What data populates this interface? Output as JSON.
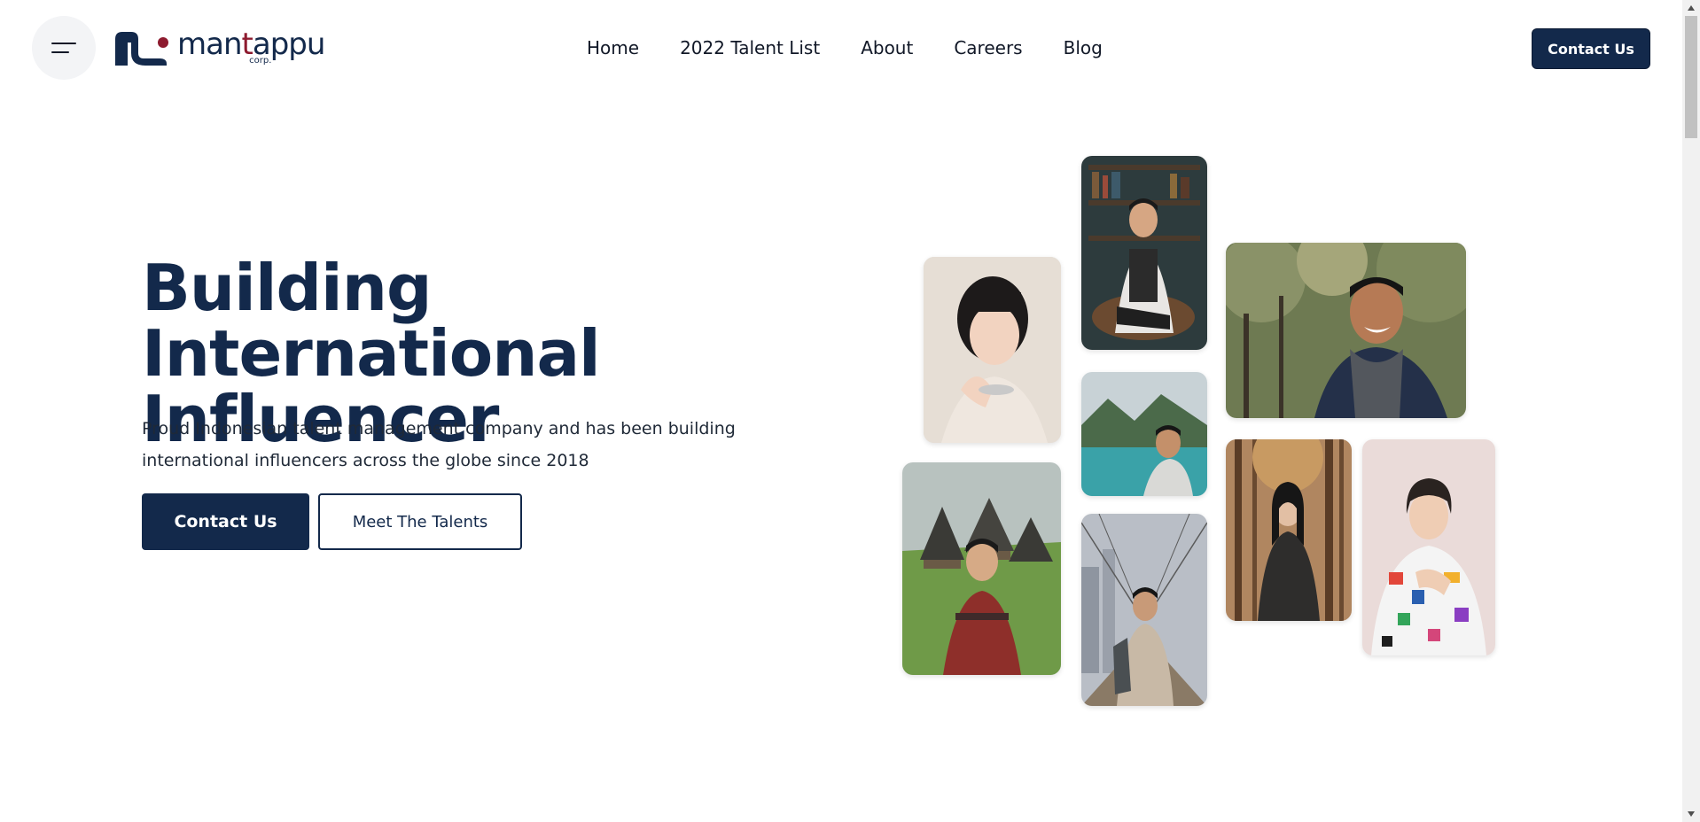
{
  "header": {
    "logo": {
      "text_part1": "man",
      "text_accent": "t",
      "text_part2": "appu",
      "subtext": "corp."
    },
    "nav": [
      {
        "label": "Home"
      },
      {
        "label": "2022 Talent List"
      },
      {
        "label": "About"
      },
      {
        "label": "Careers"
      },
      {
        "label": "Blog"
      }
    ],
    "contact_button": "Contact Us"
  },
  "hero": {
    "title_line1": "Building International",
    "title_line2": "Influencer",
    "subtitle": "Proud Indonesian talent management company and has been building international influencers across the globe since 2018",
    "primary_button": "Contact Us",
    "secondary_button": "Meet The Talents"
  },
  "gallery": {
    "photos": [
      {
        "subject": "woman-portrait"
      },
      {
        "subject": "man-sitting-bookshelf"
      },
      {
        "subject": "man-laughing-scarf"
      },
      {
        "subject": "man-coastline"
      },
      {
        "subject": "man-village-huts"
      },
      {
        "subject": "man-bridge-city"
      },
      {
        "subject": "woman-forest"
      },
      {
        "subject": "person-colorful-shirt"
      }
    ]
  },
  "colors": {
    "brand_navy": "#13294b",
    "brand_red": "#8e1b2f",
    "menu_bg": "#f3f4f6"
  },
  "icons": {
    "menu": "hamburger-icon",
    "scroll_up": "arrow-up-icon",
    "scroll_down": "arrow-down-icon"
  }
}
